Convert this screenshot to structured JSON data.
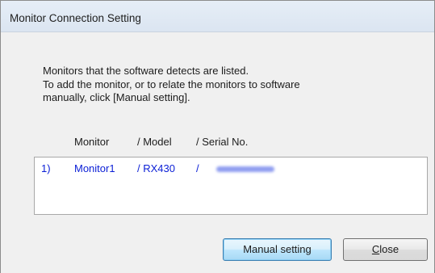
{
  "window": {
    "title": "Monitor Connection Setting"
  },
  "message": {
    "lines": [
      "Monitors that the software detects are listed.",
      "To add the monitor, or to relate the monitors to software",
      "manually, click [Manual setting]."
    ]
  },
  "list": {
    "headers": {
      "monitor": "Monitor",
      "model": "/ Model",
      "serial": "/ Serial No."
    },
    "rows": [
      {
        "index": "1)",
        "monitor": "Monitor1",
        "model": "/ RX430",
        "serial_sep": "/"
      }
    ],
    "row_color": "#0a1ed6"
  },
  "buttons": {
    "manual_setting": "Manual setting",
    "close_underlined": "C",
    "close_rest": "lose"
  },
  "colors": {
    "window_bg": "#f0f0f0",
    "default_button_border": "#3c7fb1"
  }
}
